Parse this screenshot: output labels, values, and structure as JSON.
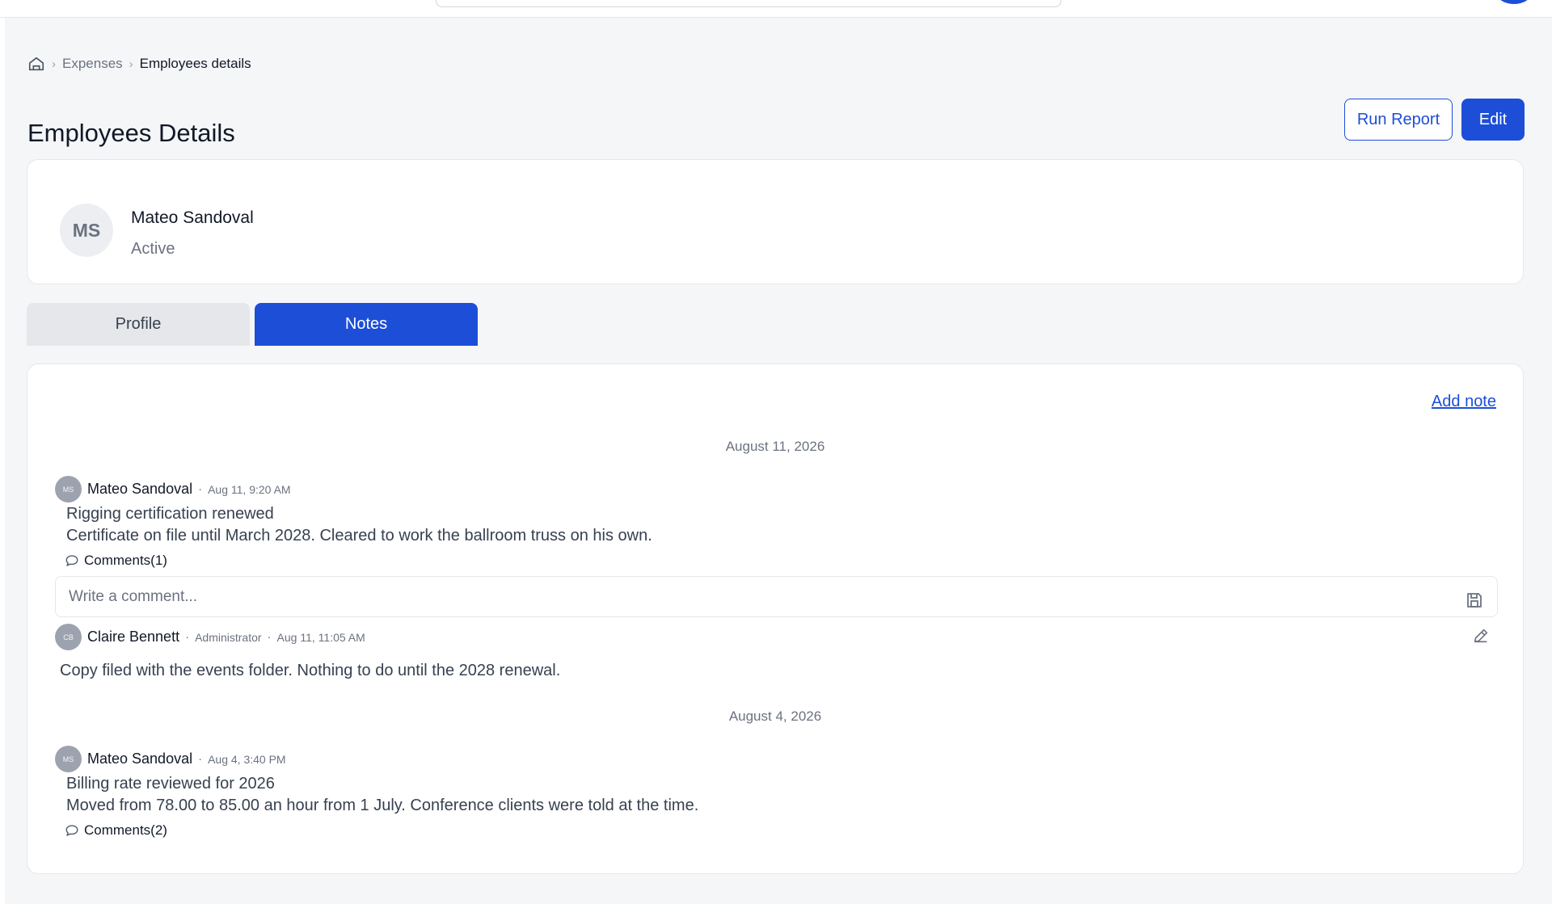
{
  "breadcrumb": {
    "items": [
      "Expenses",
      "Employees details"
    ]
  },
  "page": {
    "title": "Employees Details",
    "run_report_label": "Run Report",
    "edit_label": "Edit"
  },
  "employee": {
    "initials": "MS",
    "name": "Mateo Sandoval",
    "status": "Active"
  },
  "tabs": [
    {
      "label": "Profile",
      "active": false
    },
    {
      "label": "Notes",
      "active": true
    }
  ],
  "notes_panel": {
    "add_note_label": "Add note",
    "groups": [
      {
        "date": "August 11, 2026",
        "notes": [
          {
            "author_initials": "MS",
            "author": "Mateo Sandoval",
            "time": "Aug 11, 9:20 AM",
            "title": "Rigging certification renewed",
            "body": "Certificate on file until March 2028. Cleared to work the ballroom truss on his own.",
            "comments_label": "Comments(1)",
            "comment_placeholder": "Write a comment...",
            "comments": [
              {
                "author_initials": "CB",
                "author": "Claire Bennett",
                "role": "Administrator",
                "time": "Aug 11, 11:05 AM",
                "text": "Copy filed with the events folder. Nothing to do until the 2028 renewal."
              }
            ]
          }
        ]
      },
      {
        "date": "August 4, 2026",
        "notes": [
          {
            "author_initials": "MS",
            "author": "Mateo Sandoval",
            "time": "Aug 4, 3:40 PM",
            "title": "Billing rate reviewed for 2026",
            "body": "Moved from 78.00 to 85.00 an hour from 1 July. Conference clients were told at the time.",
            "comments_label": "Comments(2)"
          }
        ]
      }
    ]
  },
  "colors": {
    "accent": "#1d4ed8",
    "background": "#f5f6f8"
  },
  "icons": [
    "home-icon",
    "chevron-right-icon",
    "comment-icon",
    "save-icon",
    "edit-pencil-icon"
  ]
}
